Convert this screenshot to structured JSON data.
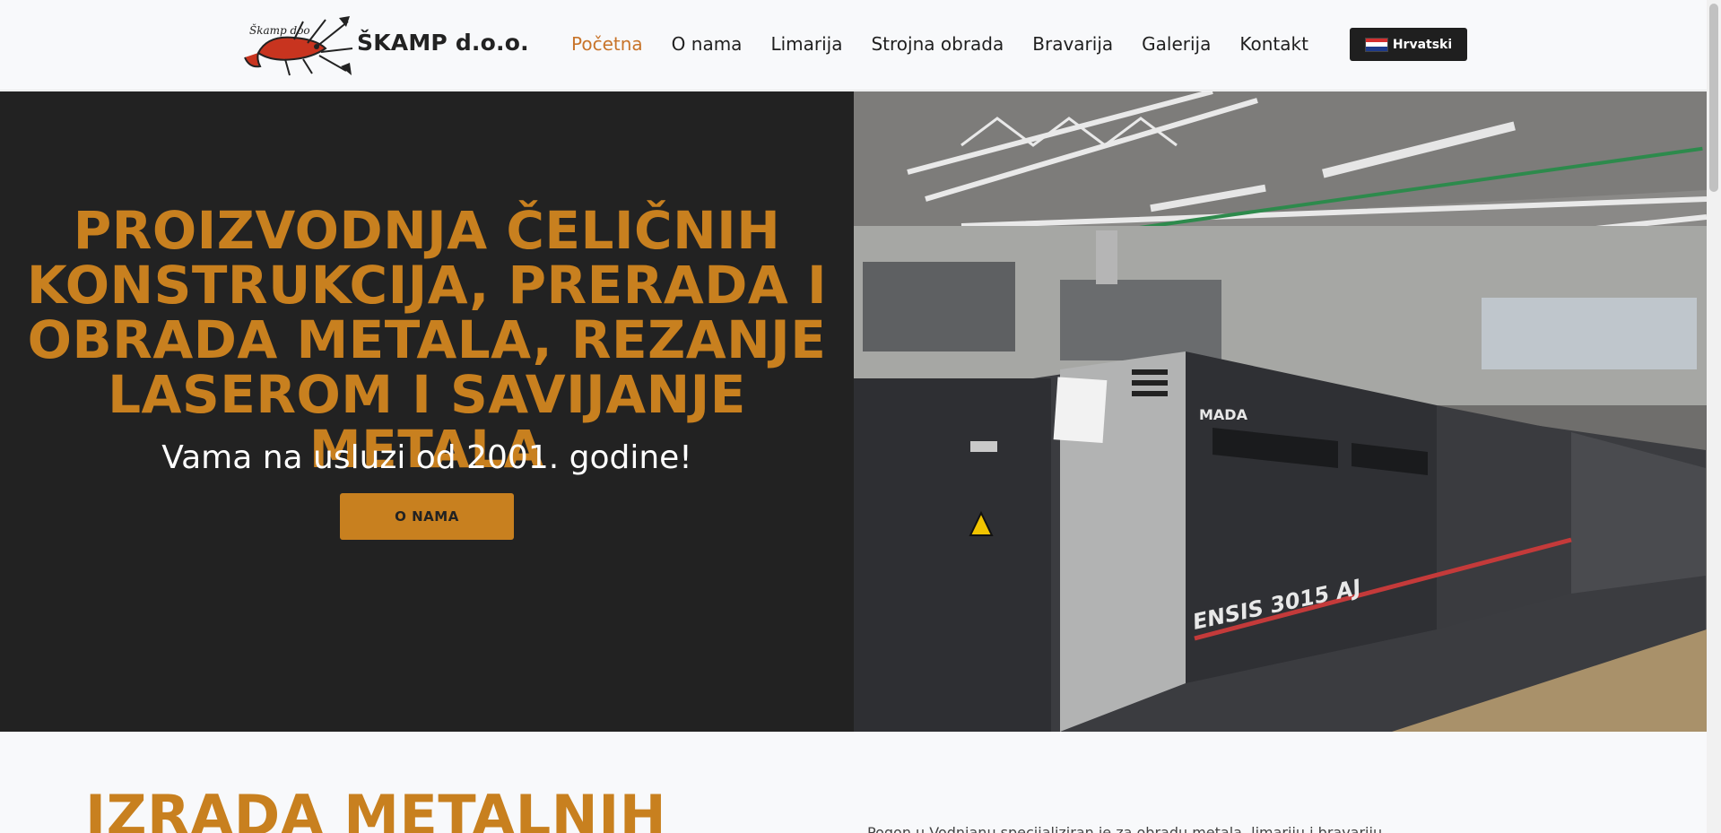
{
  "header": {
    "brand": "ŠKAMP d.o.o.",
    "logo_text": "Škamp doo",
    "nav": [
      {
        "label": "Početna",
        "active": true
      },
      {
        "label": "O nama"
      },
      {
        "label": "Limarija"
      },
      {
        "label": "Strojna obrada"
      },
      {
        "label": "Bravarija"
      },
      {
        "label": "Galerija"
      },
      {
        "label": "Kontakt"
      }
    ],
    "language": "Hrvatski"
  },
  "hero": {
    "title_lines": [
      "PROIZVODNJA ČELIČNIH",
      "KONSTRUKCIJA, PRERADA I",
      "OBRADA METALA, REZANJE",
      "LASEROM I SAVIJANJE METALA"
    ],
    "subtitle": "Vama na usluzi od 2001. godine!",
    "button": "O NAMA",
    "machine_text": {
      "brand": "MADA",
      "model": "ENSIS 3015 AJ"
    }
  },
  "section": {
    "title": "IZRADA METALNIH",
    "text": "Pogon u Vodnjanu specijaliziran je za obradu metala, limariju i bravariju"
  },
  "colors": {
    "accent": "#c8801f",
    "active_nav": "#c8742a",
    "hero_bg": "#222222"
  }
}
